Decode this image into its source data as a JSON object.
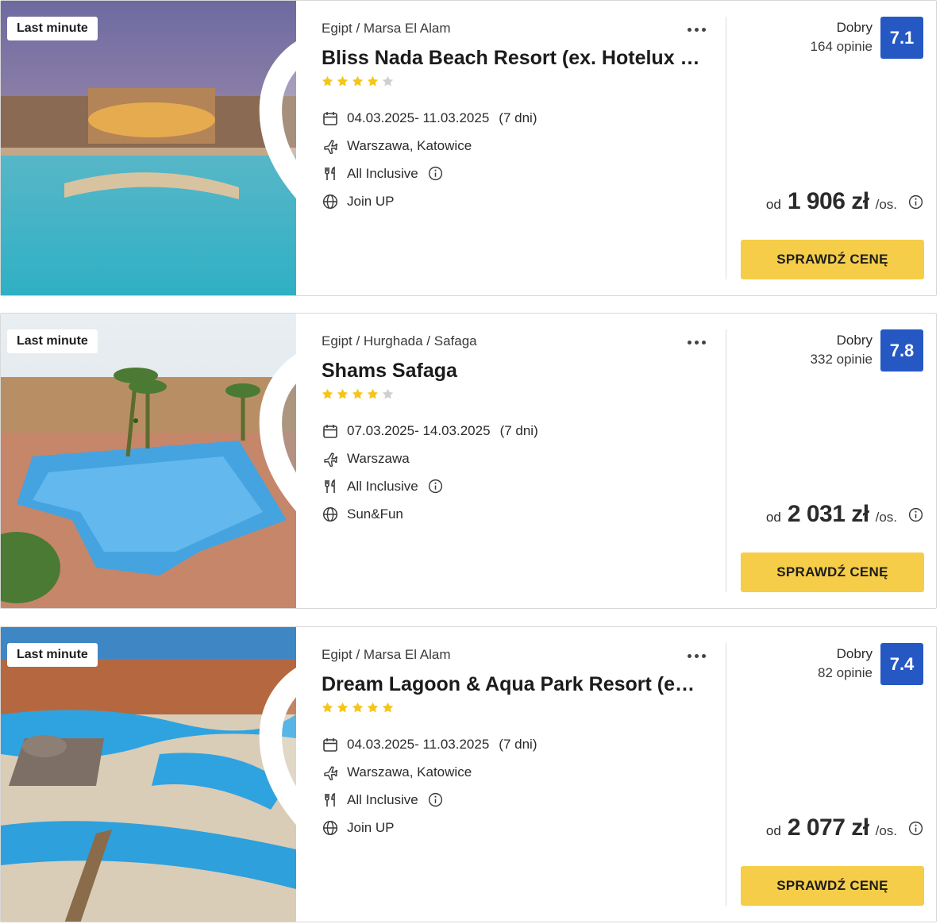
{
  "offers": [
    {
      "badge": "Last minute",
      "location": "Egipt / Marsa El Alam",
      "title": "Bliss Nada Beach Resort (ex. Hotelux Marsa Alam Resort)",
      "stars_filled": 4,
      "stars_total": 5,
      "dates": "04.03.2025- 11.03.2025",
      "duration": "(7 dni)",
      "departure": "Warszawa, Katowice",
      "board": "All Inclusive",
      "operator": "Join UP",
      "rating_label": "Dobry",
      "rating_count": "164 opinie",
      "rating_score": "7.1",
      "price_prefix": "od",
      "price": "1 906 zł",
      "price_suffix": "/os.",
      "cta": "SPRAWDŹ CENĘ",
      "favorite_filled": false
    },
    {
      "badge": "Last minute",
      "location": "Egipt / Hurghada / Safaga",
      "title": "Shams Safaga",
      "stars_filled": 4,
      "stars_total": 5,
      "dates": "07.03.2025- 14.03.2025",
      "duration": "(7 dni)",
      "departure": "Warszawa",
      "board": "All Inclusive",
      "operator": "Sun&Fun",
      "rating_label": "Dobry",
      "rating_count": "332 opinie",
      "rating_score": "7.8",
      "price_prefix": "od",
      "price": "2 031 zł",
      "price_suffix": "/os.",
      "cta": "SPRAWDŹ CENĘ",
      "favorite_filled": false
    },
    {
      "badge": "Last minute",
      "location": "Egipt / Marsa El Alam",
      "title": "Dream Lagoon & Aqua Park Resort (ex. Dream Lagoon Resort)",
      "stars_filled": 5,
      "stars_total": 5,
      "dates": "04.03.2025- 11.03.2025",
      "duration": "(7 dni)",
      "departure": "Warszawa, Katowice",
      "board": "All Inclusive",
      "operator": "Join UP",
      "rating_label": "Dobry",
      "rating_count": "82 opinie",
      "rating_score": "7.4",
      "price_prefix": "od",
      "price": "2 077 zł",
      "price_suffix": "/os.",
      "cta": "SPRAWDŹ CENĘ",
      "favorite_filled": false
    }
  ],
  "icons": {
    "favorite": "heart-icon",
    "more": "more-dots-icon",
    "dates": "calendar-icon",
    "departure": "plane-icon",
    "board": "cutlery-icon",
    "operator": "globe-icon",
    "info": "info-icon"
  },
  "colors": {
    "rating_badge": "#2658c4",
    "cta_background": "#f5cd48",
    "star_filled": "#f5c518",
    "star_empty": "#cfcfcf"
  }
}
